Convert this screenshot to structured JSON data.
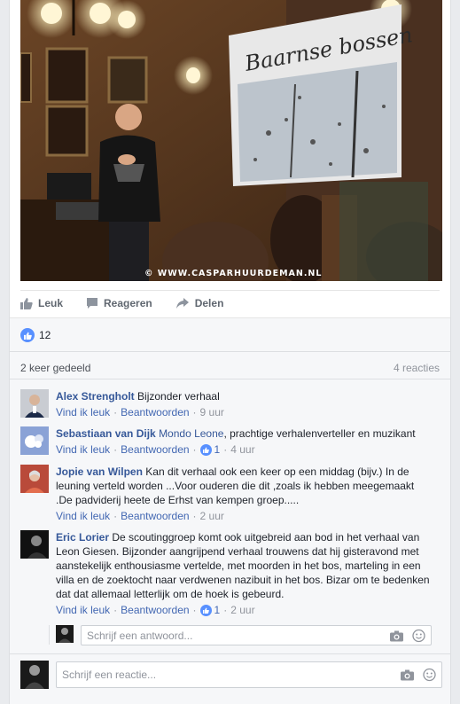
{
  "photo": {
    "credit": "© WWW.CASPARHUURDEMAN.NL",
    "screen_text": "Baarnse bossen"
  },
  "actions": {
    "like": "Leuk",
    "comment": "Reageren",
    "share": "Delen"
  },
  "summary": {
    "likes_count": "12",
    "shares": "2 keer gedeeld",
    "reacties": "4 reacties"
  },
  "comments": [
    {
      "name": "Alex Strengholt",
      "text": "Bijzonder verhaal",
      "like": "Vind ik leuk",
      "reply": "Beantwoorden",
      "time": "9 uur"
    },
    {
      "name": "Sebastiaan van Dijk",
      "mention": "Mondo Leone",
      "text": ", prachtige verhalenverteller en muzikant",
      "like": "Vind ik leuk",
      "reply": "Beantwoorden",
      "likes": "1",
      "time": "4 uur"
    },
    {
      "name": "Jopie van Wilpen",
      "text": "Kan dit verhaal ook een keer op een middag (bijv.) In de leuning verteld worden ...Voor ouderen die dit ,zoals ik hebben meegemaakt .De padviderij heete de Erhst van kempen groep.....",
      "like": "Vind ik leuk",
      "reply": "Beantwoorden",
      "time": "2 uur"
    },
    {
      "name": "Eric Lorier",
      "text": "De scoutinggroep komt ook uitgebreid aan bod in het verhaal van Leon Giesen. Bijzonder aangrijpend verhaal trouwens dat hij gisteravond met aanstekelijk enthousiasme vertelde, met moorden in het bos, marteling in een villa en de zoektocht naar verdwenen nazibuit in het bos. Bizar om te bedenken dat dat allemaal letterlijk om de hoek is gebeurd.",
      "like": "Vind ik leuk",
      "reply": "Beantwoorden",
      "likes": "1",
      "time": "2 uur"
    }
  ],
  "reply_input": {
    "placeholder": "Schrijf een antwoord..."
  },
  "comment_input": {
    "placeholder": "Schrijf een reactie..."
  },
  "colors": {
    "link": "#365899",
    "meta": "#90949c",
    "like_blue": "#5890ff"
  },
  "icons": [
    "thumbs-up-icon",
    "speech-bubble-icon",
    "share-arrow-icon",
    "camera-icon",
    "smiley-icon"
  ]
}
